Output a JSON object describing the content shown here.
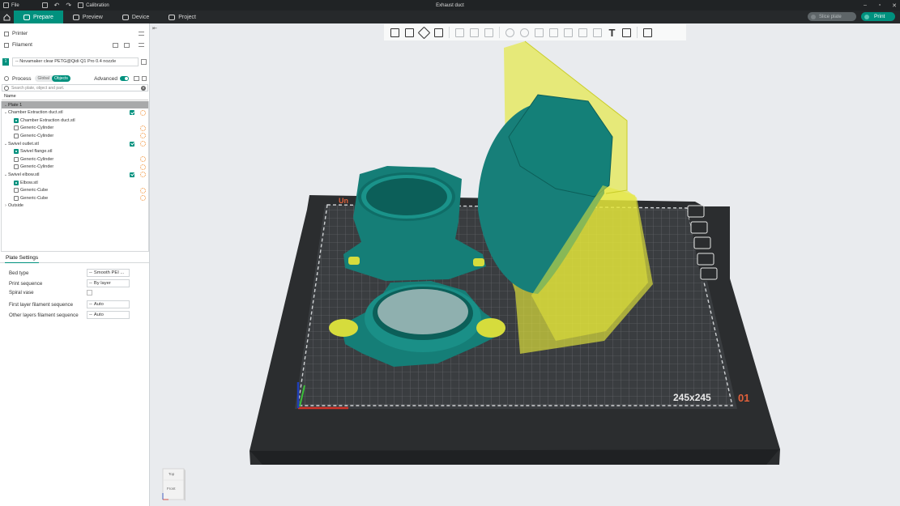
{
  "titlebar": {
    "file_label": "File",
    "calibration_label": "Calibration",
    "window_title": "Exhaust duct"
  },
  "tabs": [
    {
      "label": "Prepare",
      "active": true
    },
    {
      "label": "Preview",
      "active": false
    },
    {
      "label": "Device",
      "active": false
    },
    {
      "label": "Project",
      "active": false
    }
  ],
  "actions": {
    "slice_label": "Slice plate",
    "print_label": "Print"
  },
  "sidebar": {
    "printer_label": "Printer",
    "filament_label": "Filament",
    "filament_index": "1",
    "filament_value": "-- Novamaker clear PETG@Qidi Q1 Pro 0.4 nozzle",
    "process_label": "Process",
    "process_tabs": [
      "Global",
      "Objects"
    ],
    "advanced_label": "Advanced",
    "search_placeholder": "Search plate, object and part.",
    "name_header": "Name"
  },
  "tree": [
    {
      "label": "Plate 1",
      "level": 0,
      "kind": "plate",
      "selected": true
    },
    {
      "label": "Chamber Extraction duct.stl",
      "level": 1,
      "kind": "object"
    },
    {
      "label": "Chamber Extraction duct.stl",
      "level": 2,
      "kind": "part"
    },
    {
      "label": "Generic-Cylinder",
      "level": 2,
      "kind": "modifier"
    },
    {
      "label": "Generic-Cylinder",
      "level": 2,
      "kind": "modifier"
    },
    {
      "label": "Swivel outlet.stl",
      "level": 1,
      "kind": "object"
    },
    {
      "label": "Swivel flange.stl",
      "level": 2,
      "kind": "part"
    },
    {
      "label": "Generic-Cylinder",
      "level": 2,
      "kind": "modifier"
    },
    {
      "label": "Generic-Cylinder",
      "level": 2,
      "kind": "modifier"
    },
    {
      "label": "Swivel elbow.stl",
      "level": 1,
      "kind": "object"
    },
    {
      "label": "Elbow.stl",
      "level": 2,
      "kind": "part"
    },
    {
      "label": "Generic-Cube",
      "level": 2,
      "kind": "modifier"
    },
    {
      "label": "Generic-Cube",
      "level": 2,
      "kind": "modifier"
    },
    {
      "label": "Outside",
      "level": 0,
      "kind": "plate"
    }
  ],
  "plate_settings": {
    "title": "Plate Settings",
    "bed_type_label": "Bed type",
    "bed_type_value": "Smooth PEI ...",
    "print_sequence_label": "Print sequence",
    "print_sequence_value": "By layer",
    "spiral_vase_label": "Spiral vase",
    "first_layer_label": "First layer filament sequence",
    "first_layer_value": "Auto",
    "other_layers_label": "Other layers filament sequence",
    "other_layers_value": "Auto"
  },
  "viewport": {
    "bed_size_label": "245x245",
    "plate_number": "01",
    "navcube_top": "Top",
    "navcube_front": "Front"
  },
  "colors": {
    "accent": "#00917e",
    "model_teal": "#178a82",
    "modifier_yellow": "#e1e53c",
    "bed": "#2c2e30"
  }
}
